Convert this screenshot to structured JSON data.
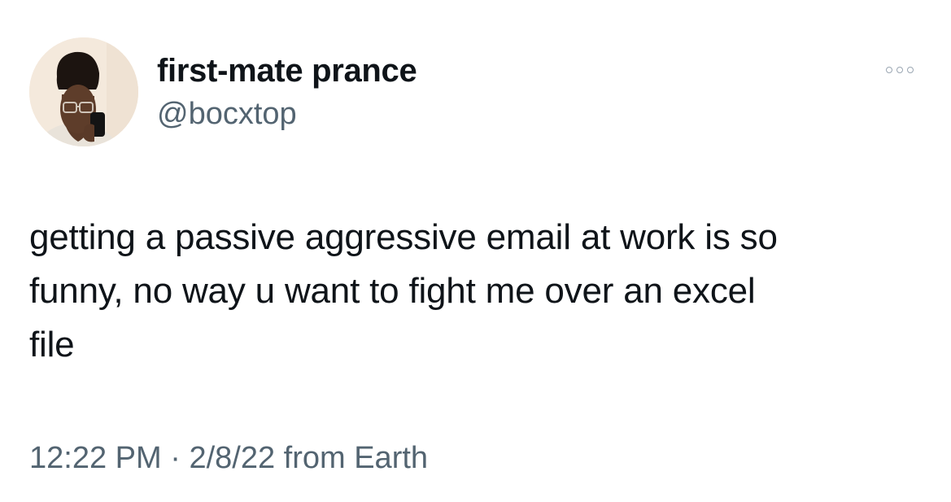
{
  "author": {
    "display_name": "first-mate prance",
    "handle": "@bocxtop",
    "avatar_icon": "profile-photo"
  },
  "menu": {
    "icon": "more-horizontal-icon"
  },
  "tweet": {
    "text_lines": [
      "getting a passive aggressive email at work is so",
      "funny, no way u want to fight me over an excel",
      "file"
    ]
  },
  "meta": {
    "time": "12:22 PM",
    "separator": "·",
    "date": "2/8/22",
    "source": "from Earth"
  },
  "colors": {
    "text_primary": "#0f1419",
    "text_secondary": "#536471",
    "background": "#ffffff"
  }
}
